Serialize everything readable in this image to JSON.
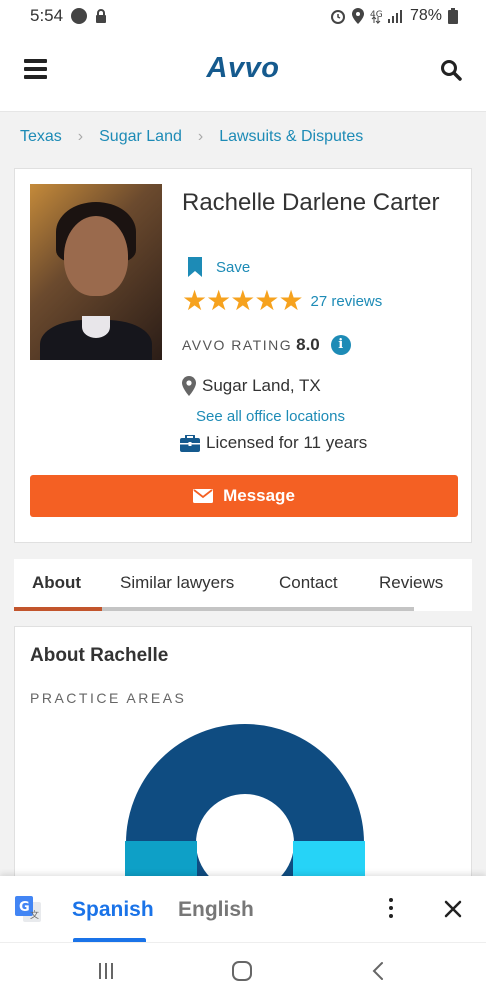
{
  "status_bar": {
    "time": "5:54",
    "battery": "78%"
  },
  "header": {
    "logo": "Avvo"
  },
  "breadcrumb": [
    "Texas",
    "Sugar Land",
    "Lawsuits & Disputes"
  ],
  "profile": {
    "name": "Rachelle Darlene Carter",
    "save_label": "Save",
    "star_count": 5,
    "reviews": "27 reviews",
    "rating_label": "AVVO RATING",
    "rating_value": "8.0",
    "location": "Sugar Land, TX",
    "office_link": "See all office locations",
    "licensed": "Licensed for 11 years",
    "message_button": "Message"
  },
  "tabs": [
    "About",
    "Similar lawyers",
    "Contact",
    "Reviews"
  ],
  "about": {
    "title": "About Rachelle",
    "practice_areas_label": "PRACTICE AREAS"
  },
  "translate_bar": {
    "lang_active": "Spanish",
    "lang_other": "English"
  },
  "colors": {
    "brand": "#155a8e",
    "link": "#1d8bb6",
    "cta": "#f46023",
    "star": "#f6a21e"
  }
}
